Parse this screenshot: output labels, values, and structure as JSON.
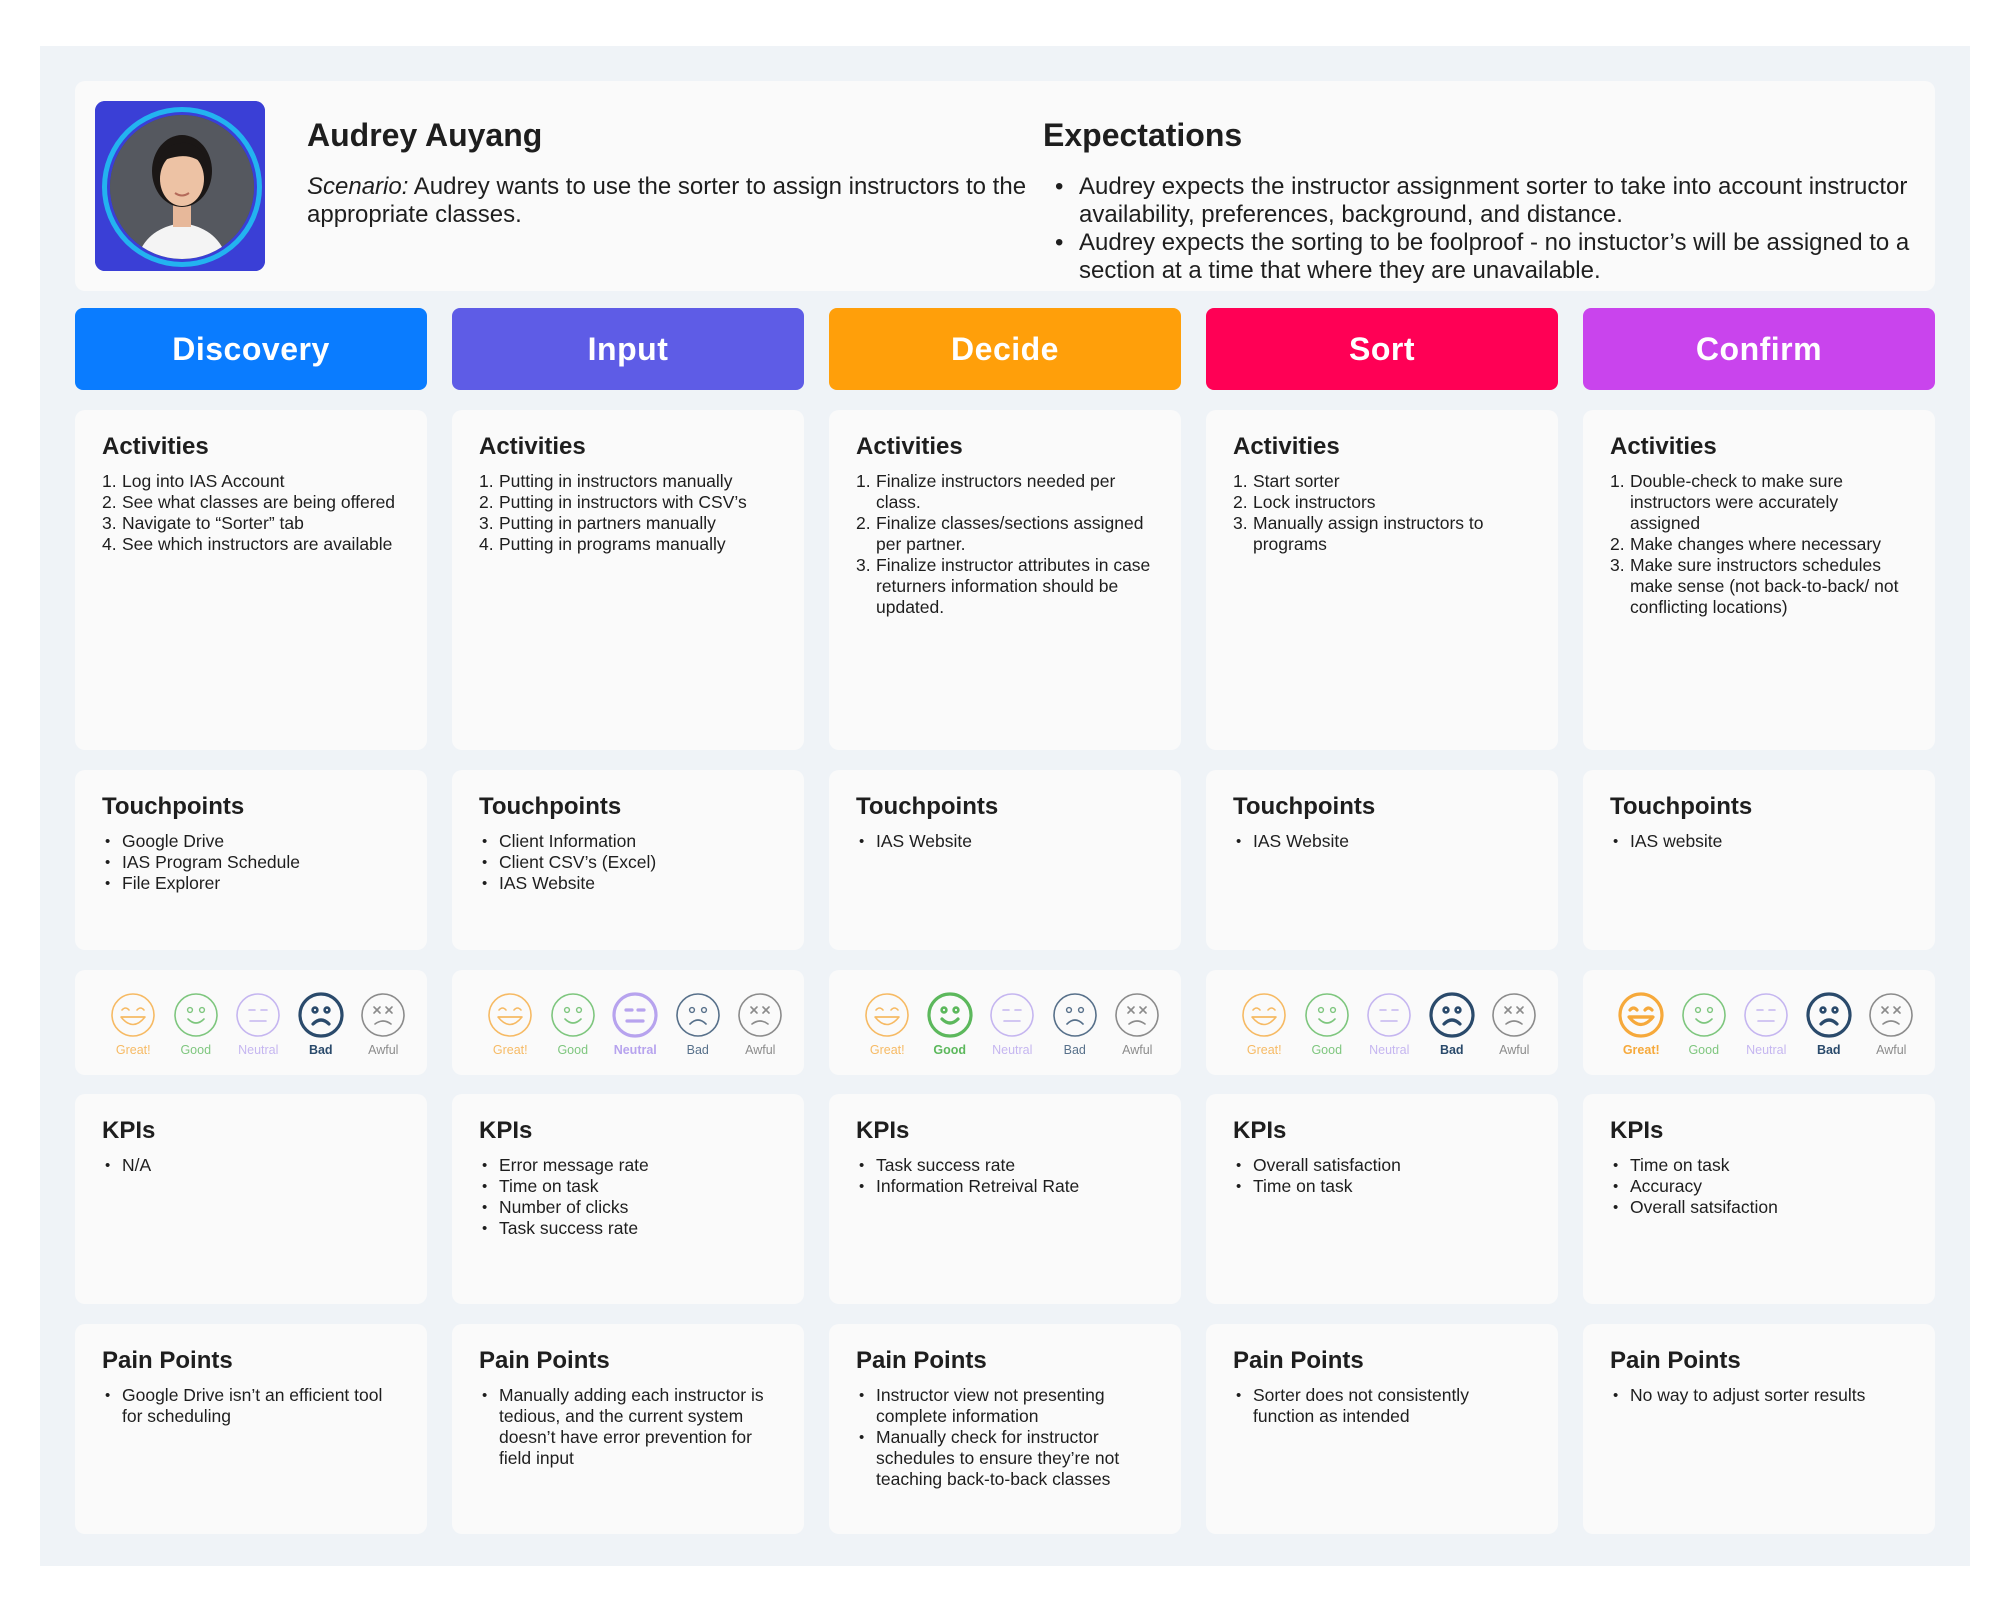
{
  "colors": {
    "great": "#f6a93b",
    "good": "#5cb85c",
    "neutral": "#b7a3ee",
    "bad": "#2a4a6b",
    "awful": "#6d6d6d"
  },
  "persona": {
    "name": "Audrey Auyang",
    "scenario_label": "Scenario:",
    "scenario_text": " Audrey wants to use the sorter to assign instructors to the appropriate classes.",
    "expectations_title": "Expectations",
    "expectations": [
      "Audrey expects the instructor assignment sorter to take into account instructor availability, preferences, background, and distance.",
      "Audrey expects the sorting to be foolproof - no instuctor’s will be assigned to a section at a time that where they are unavailable."
    ]
  },
  "section_titles": {
    "activities": "Activities",
    "touchpoints": "Touchpoints",
    "kpis": "KPIs",
    "pain_points": "Pain Points"
  },
  "emotion_labels": [
    "Great!",
    "Good",
    "Neutral",
    "Bad",
    "Awful"
  ],
  "stages": [
    {
      "name": "Discovery",
      "color": "#0a7cff",
      "activities": [
        "Log into IAS Account",
        "See what classes are being offered",
        "Navigate to “Sorter” tab",
        "See which instructors are available"
      ],
      "touchpoints": [
        "Google Drive",
        "IAS Program Schedule",
        "File Explorer"
      ],
      "emotion": "Bad",
      "kpis": [
        "N/A"
      ],
      "pain_points": [
        "Google Drive isn’t an efficient tool for scheduling"
      ]
    },
    {
      "name": "Input",
      "color": "#5e5ce6",
      "activities": [
        "Putting in instructors manually",
        "Putting in instructors with CSV’s",
        "Putting in partners manually",
        "Putting in programs manually"
      ],
      "touchpoints": [
        "Client Information",
        "Client CSV’s (Excel)",
        "IAS Website"
      ],
      "emotion": "Neutral",
      "kpis": [
        "Error message rate",
        "Time on task",
        "Number of clicks",
        "Task success rate"
      ],
      "pain_points": [
        "Manually adding each instructor is tedious, and the current system doesn’t have error prevention for field input"
      ]
    },
    {
      "name": "Decide",
      "color": "#ff9f0a",
      "activities": [
        "Finalize instructors needed per class.",
        "Finalize classes/sections assigned per partner.",
        "Finalize instructor attributes in case returners information should be updated."
      ],
      "touchpoints": [
        "IAS Website"
      ],
      "emotion": "Good",
      "kpis": [
        "Task success rate",
        "Information Retreival Rate"
      ],
      "pain_points": [
        "Instructor view not presenting complete information",
        "Manually check for instructor schedules to ensure they’re not teaching back-to-back classes"
      ]
    },
    {
      "name": "Sort",
      "color": "#ff0055",
      "activities": [
        "Start sorter",
        "Lock instructors",
        "Manually assign instructors to programs"
      ],
      "touchpoints": [
        "IAS Website"
      ],
      "emotion": "Bad",
      "kpis": [
        "Overall satisfaction",
        "Time on task"
      ],
      "pain_points": [
        "Sorter does not consistently function as intended"
      ]
    },
    {
      "name": "Confirm",
      "color": "#c944ed",
      "activities": [
        "Double-check to make sure instructors were accurately assigned",
        "Make changes where necessary",
        "Make sure instructors schedules make sense (not back-to-back/ not conflicting locations)"
      ],
      "touchpoints": [
        "IAS website"
      ],
      "emotion": "Great! + Bad",
      "kpis": [
        "Time on task",
        "Accuracy",
        "Overall satsifaction"
      ],
      "pain_points": [
        "No way to adjust sorter results"
      ]
    }
  ]
}
